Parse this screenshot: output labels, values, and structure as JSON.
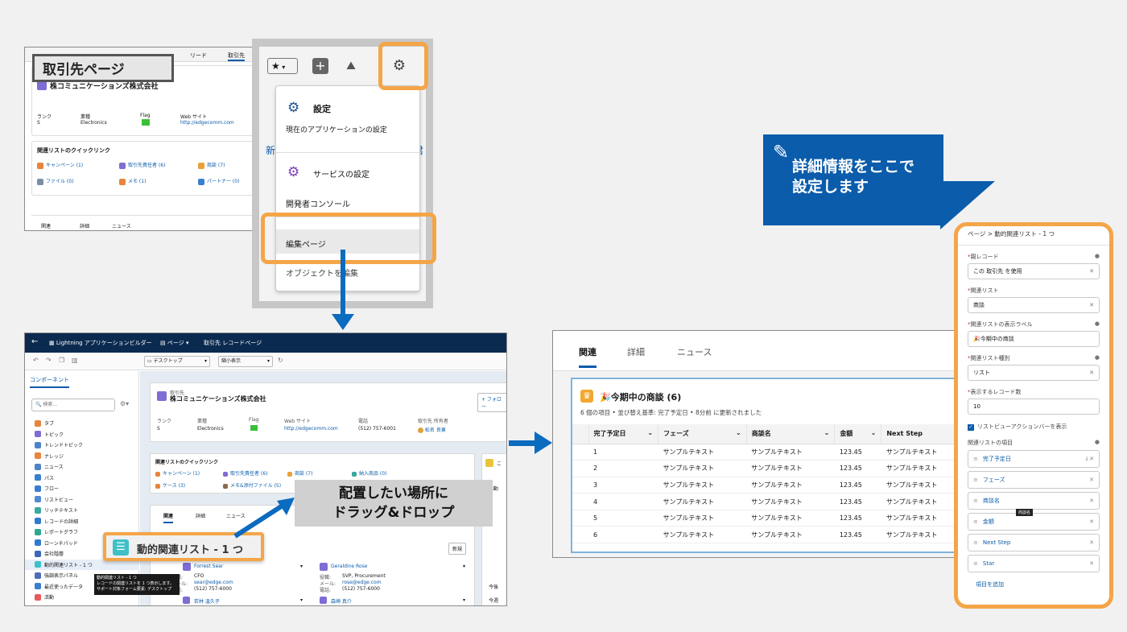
{
  "shot1": {
    "top_tabs": [
      "リード",
      "取引先"
    ],
    "label_badge": "取引先ページ",
    "account_name": "株コミュニケーションズ株式会社",
    "fields": [
      {
        "label": "ランク",
        "value": "S"
      },
      {
        "label": "業種",
        "value": "Electronics"
      },
      {
        "label": "Flag",
        "value": ""
      },
      {
        "label": "Web サイト",
        "value": "http://edgecomm.com"
      }
    ],
    "quicklinks_title": "関連リストのクイックリンク",
    "quicklinks": [
      "キャンペーン (1)",
      "取引先責任者 (6)",
      "商談 (7)",
      "ファイル (0)",
      "メモ (1)",
      "パートナー (0)"
    ],
    "bottom_tabs": [
      "関連",
      "詳細",
      "ニュース"
    ]
  },
  "menu": {
    "settings_title": "設定",
    "settings_sub": "現在のアプリケーションの設定",
    "service_settings": "サービスの設定",
    "dev_console": "開発者コンソール",
    "edit_page": "編集ページ",
    "object_manager": "オブジェクトを編集",
    "bg_left": "新規",
    "bg_right": "君"
  },
  "builder": {
    "app_title": "Lightning アプリケーションビルダー",
    "page_menu": "ページ",
    "page_name": "取引先 レコードページ",
    "device": "デスクトップ",
    "view": "縮小表示",
    "components_tab": "コンポーネント",
    "search_placeholder": "検索...",
    "components": [
      "タブ",
      "トピック",
      "トレンドトピック",
      "ナレッジ",
      "ニュース",
      "パス",
      "フロー",
      "リストビュー",
      "リッチテキスト",
      "レコードの詳細",
      "レポートグラフ",
      "ローンチパッド",
      "会社階層",
      "動的関連リスト - 1 つ",
      "強調表示パネル",
      "最近使ったデータ",
      "活動"
    ],
    "component_colors": [
      "#e8843b",
      "#7f6cd4",
      "#4f83c8",
      "#e8843b",
      "#4f83c8",
      "#3a7ecf",
      "#3a7ecf",
      "#4e8bd4",
      "#3aa8a0",
      "#2f7ad0",
      "#2fa68f",
      "#2f7ad0",
      "#3b67b5",
      "#3ec0c8",
      "#4e6db8",
      "#3a7ecf",
      "#e85a5a"
    ],
    "account_small": "取引先",
    "account_name": "株コミュニケーションズ株式会社",
    "follow": "+ フォロー",
    "fields": [
      {
        "label": "ランク",
        "value": "S"
      },
      {
        "label": "業種",
        "value": "Electronics"
      },
      {
        "label": "Flag",
        "value": ""
      },
      {
        "label": "Web サイト",
        "value": "http://edgecomm.com"
      },
      {
        "label": "電話",
        "value": "(512) 757-6001"
      },
      {
        "label": "取引先 所有者",
        "value": "松名 良東"
      }
    ],
    "quicklinks_title": "関連リストのクイックリンク",
    "quicklinks": [
      "キャンペーン (1)",
      "取引先責任者 (6)",
      "商談 (7)",
      "納入商品 (0)",
      "ケース (3)",
      "メモ&添付ファイル (5)"
    ],
    "tabs": [
      "関連",
      "詳細",
      "ニュース"
    ],
    "drag_label": "配置したい場所に\nドラッグ&ドロップ",
    "dragged_component": "動的関連リスト - 1 つ",
    "tooltip": "動的関連リスト - 1 つ\nレコードの関連リストを 1 つ表示します。\nサポート対象フォーム要素: デスクトップ",
    "new_button": "新規",
    "contacts": [
      {
        "name": "Forrest Sear",
        "title": "CFO",
        "email": "sear@edge.com",
        "phone": "(512) 757-6000"
      },
      {
        "name": "Geraldine Rose",
        "title": "SVP, Procurement",
        "email": "rose@edge.com",
        "phone": "(512) 757-6000"
      }
    ],
    "contact_labels": [
      "役職:",
      "メール:",
      "電話:"
    ],
    "bottom_names": [
      "若林 温久子",
      "森崎 真介"
    ],
    "right_labels": [
      "こ",
      "活動",
      "今後",
      "今週"
    ]
  },
  "related": {
    "tabs": [
      "関連",
      "詳細",
      "ニュース"
    ],
    "list_title": "今期中の商談 (6)",
    "list_sub": "6 個の項目 • 並び替え基準: 完了予定日 • 8分前 に更新されました",
    "columns": [
      "完了予定日",
      "フェーズ",
      "商談名",
      "金額",
      "Next Step"
    ],
    "rows": [
      [
        "1",
        "サンプルテキスト",
        "サンプルテキスト",
        "123.45",
        "サンプルテキスト"
      ],
      [
        "2",
        "サンプルテキスト",
        "サンプルテキスト",
        "123.45",
        "サンプルテキスト"
      ],
      [
        "3",
        "サンプルテキスト",
        "サンプルテキスト",
        "123.45",
        "サンプルテキスト"
      ],
      [
        "4",
        "サンプルテキスト",
        "サンプルテキスト",
        "123.45",
        "サンプルテキスト"
      ],
      [
        "5",
        "サンプルテキスト",
        "サンプルテキスト",
        "123.45",
        "サンプルテキスト"
      ],
      [
        "6",
        "サンプルテキスト",
        "サンプルテキスト",
        "123.45",
        "サンプルテキスト"
      ]
    ]
  },
  "callout": {
    "text": "詳細情報をここで\n設定します"
  },
  "panel": {
    "breadcrumb": "ページ > 動的関連リスト - 1 つ",
    "parent_label": "親レコード",
    "parent_value": "この 取引先 を使用",
    "list_label": "関連リスト",
    "list_value": "商談",
    "display_label_label": "関連リストの表示ラベル",
    "display_label_value": "今期中の商談",
    "type_label": "関連リスト種別",
    "type_value": "リスト",
    "count_label": "表示するレコード数",
    "count_value": "10",
    "checkbox_label": "リストビューアクションバーを表示",
    "fields_title": "関連リストの項目",
    "fields": [
      "完了予定日",
      "フェーズ",
      "商談名",
      "金額",
      "Next Step",
      "Star"
    ],
    "tooltip_small": "商談名",
    "add_field": "項目を追加"
  },
  "colors": {
    "accent_orange": "#f4a548",
    "arrow_blue": "#0b6bbf",
    "callout_blue": "#0b5cab",
    "builder_nav": "#0b2a4f"
  }
}
